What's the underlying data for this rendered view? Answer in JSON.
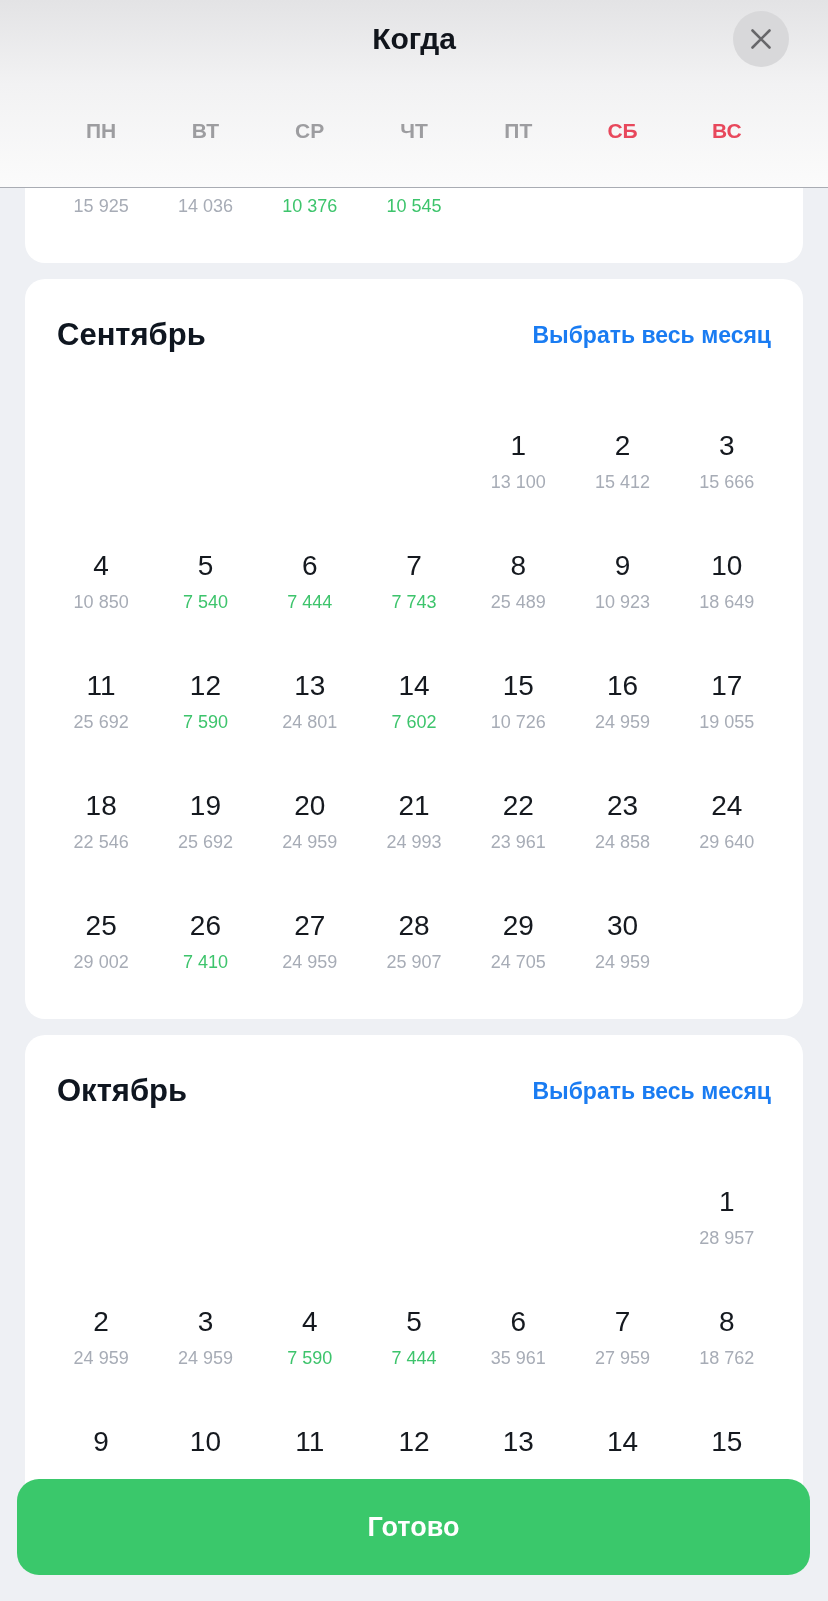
{
  "header": {
    "title": "Когда",
    "weekdays": [
      {
        "label": "ПН",
        "weekend": false
      },
      {
        "label": "ВТ",
        "weekend": false
      },
      {
        "label": "СР",
        "weekend": false
      },
      {
        "label": "ЧТ",
        "weekend": false
      },
      {
        "label": "ПТ",
        "weekend": false
      },
      {
        "label": "СБ",
        "weekend": true
      },
      {
        "label": "ВС",
        "weekend": true
      }
    ]
  },
  "months": [
    {
      "weeks": [
        [
          {
            "kind": "date",
            "price": "15 925",
            "low_price": false
          },
          {
            "kind": "date",
            "price": "14 036",
            "low_price": false
          },
          {
            "kind": "date",
            "price": "10 376",
            "low_price": true
          },
          {
            "kind": "date",
            "price": "10 545",
            "low_price": true
          }
        ]
      ]
    },
    {
      "name": "Сентябрь",
      "select_month_link": "Выбрать весь месяц",
      "weeks": [
        [
          {
            "kind": "blank"
          },
          {
            "kind": "blank"
          },
          {
            "kind": "blank"
          },
          {
            "kind": "blank"
          },
          {
            "kind": "date",
            "day": "1",
            "price": "13 100",
            "low_price": false
          },
          {
            "kind": "date",
            "day": "2",
            "price": "15 412",
            "low_price": false
          },
          {
            "kind": "date",
            "day": "3",
            "price": "15 666",
            "low_price": false
          }
        ],
        [
          {
            "kind": "date",
            "day": "4",
            "price": "10 850",
            "low_price": false
          },
          {
            "kind": "date",
            "day": "5",
            "price": "7 540",
            "low_price": true
          },
          {
            "kind": "date",
            "day": "6",
            "price": "7 444",
            "low_price": true
          },
          {
            "kind": "date",
            "day": "7",
            "price": "7 743",
            "low_price": true
          },
          {
            "kind": "date",
            "day": "8",
            "price": "25 489",
            "low_price": false
          },
          {
            "kind": "date",
            "day": "9",
            "price": "10 923",
            "low_price": false
          },
          {
            "kind": "date",
            "day": "10",
            "price": "18 649",
            "low_price": false
          }
        ],
        [
          {
            "kind": "date",
            "day": "11",
            "price": "25 692",
            "low_price": false
          },
          {
            "kind": "date",
            "day": "12",
            "price": "7 590",
            "low_price": true
          },
          {
            "kind": "date",
            "day": "13",
            "price": "24 801",
            "low_price": false
          },
          {
            "kind": "date",
            "day": "14",
            "price": "7 602",
            "low_price": true
          },
          {
            "kind": "date",
            "day": "15",
            "price": "10 726",
            "low_price": false
          },
          {
            "kind": "date",
            "day": "16",
            "price": "24 959",
            "low_price": false
          },
          {
            "kind": "date",
            "day": "17",
            "price": "19 055",
            "low_price": false
          }
        ],
        [
          {
            "kind": "date",
            "day": "18",
            "price": "22 546",
            "low_price": false
          },
          {
            "kind": "date",
            "day": "19",
            "price": "25 692",
            "low_price": false
          },
          {
            "kind": "date",
            "day": "20",
            "price": "24 959",
            "low_price": false
          },
          {
            "kind": "date",
            "day": "21",
            "price": "24 993",
            "low_price": false
          },
          {
            "kind": "date",
            "day": "22",
            "price": "23 961",
            "low_price": false
          },
          {
            "kind": "date",
            "day": "23",
            "price": "24 858",
            "low_price": false
          },
          {
            "kind": "date",
            "day": "24",
            "price": "29 640",
            "low_price": false
          }
        ],
        [
          {
            "kind": "date",
            "day": "25",
            "price": "29 002",
            "low_price": false
          },
          {
            "kind": "date",
            "day": "26",
            "price": "7 410",
            "low_price": true
          },
          {
            "kind": "date",
            "day": "27",
            "price": "24 959",
            "low_price": false
          },
          {
            "kind": "date",
            "day": "28",
            "price": "25 907",
            "low_price": false
          },
          {
            "kind": "date",
            "day": "29",
            "price": "24 705",
            "low_price": false
          },
          {
            "kind": "date",
            "day": "30",
            "price": "24 959",
            "low_price": false
          }
        ]
      ]
    },
    {
      "name": "Октябрь",
      "select_month_link": "Выбрать весь месяц",
      "weeks": [
        [
          {
            "kind": "blank"
          },
          {
            "kind": "blank"
          },
          {
            "kind": "blank"
          },
          {
            "kind": "blank"
          },
          {
            "kind": "blank"
          },
          {
            "kind": "blank"
          },
          {
            "kind": "date",
            "day": "1",
            "price": "28 957",
            "low_price": false
          }
        ],
        [
          {
            "kind": "date",
            "day": "2",
            "price": "24 959",
            "low_price": false
          },
          {
            "kind": "date",
            "day": "3",
            "price": "24 959",
            "low_price": false
          },
          {
            "kind": "date",
            "day": "4",
            "price": "7 590",
            "low_price": true
          },
          {
            "kind": "date",
            "day": "5",
            "price": "7 444",
            "low_price": true
          },
          {
            "kind": "date",
            "day": "6",
            "price": "35 961",
            "low_price": false
          },
          {
            "kind": "date",
            "day": "7",
            "price": "27 959",
            "low_price": false
          },
          {
            "kind": "date",
            "day": "8",
            "price": "18 762",
            "low_price": false
          }
        ],
        [
          {
            "kind": "date",
            "day": "9"
          },
          {
            "kind": "date",
            "day": "10"
          },
          {
            "kind": "date",
            "day": "11"
          },
          {
            "kind": "date",
            "day": "12"
          },
          {
            "kind": "date",
            "day": "13"
          },
          {
            "kind": "date",
            "day": "14"
          },
          {
            "kind": "date",
            "day": "15"
          }
        ]
      ]
    }
  ],
  "done_button": {
    "label": "Готово"
  }
}
